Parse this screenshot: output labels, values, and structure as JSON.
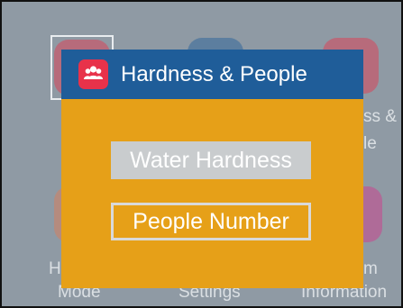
{
  "dialog": {
    "title": "Hardness & People",
    "icon": "people-icon",
    "options": [
      {
        "label": "Water Hardness",
        "state": "highlighted"
      },
      {
        "label": "People Number",
        "state": "selected"
      }
    ]
  },
  "background_menu": {
    "partial_labels": {
      "top_right_line1": "ss &",
      "top_right_line2": "le",
      "bottom_left_line1": "H",
      "bottom_left_line2": "Mode",
      "bottom_middle": "Settings",
      "bottom_right_line1": "m",
      "bottom_right_line2": "Information"
    }
  },
  "colors": {
    "dialog_body": "#e6a018",
    "dialog_header": "#1f5d99",
    "icon_bg": "#e8324a",
    "screen_bg": "#8f9aa4"
  }
}
